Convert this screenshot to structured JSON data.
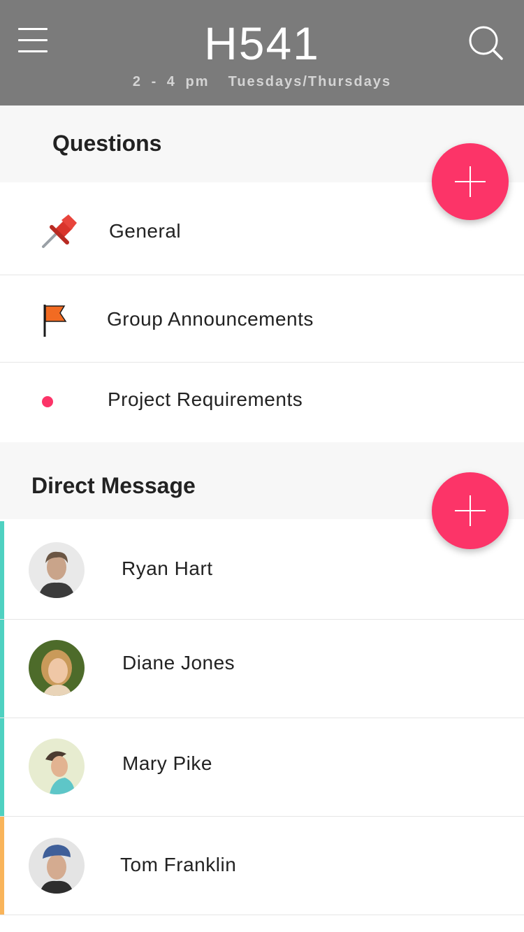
{
  "header": {
    "title": "H541",
    "subtitle": "2 - 4 pm  Tuesdays/Thursdays",
    "menu_icon": "hamburger-menu-icon",
    "search_icon": "search-icon"
  },
  "questions": {
    "title": "Questions",
    "items": [
      {
        "label": "General",
        "icon": "pushpin-icon"
      },
      {
        "label": "Group Announcements",
        "icon": "flag-icon"
      },
      {
        "label": "Project Requirements",
        "icon": "dot-icon"
      }
    ]
  },
  "direct_message": {
    "title": "Direct Message",
    "contacts": [
      {
        "name": "Ryan Hart",
        "accent": "#4fd1c1"
      },
      {
        "name": "Diane Jones",
        "accent": "#4fd1c1"
      },
      {
        "name": "Mary Pike",
        "accent": "#4fd1c1"
      },
      {
        "name": "Tom Franklin",
        "accent": "#f9b45a"
      }
    ]
  },
  "colors": {
    "header_bg": "#7b7b7b",
    "fab": "#fc3468",
    "accent_teal": "#4fd1c1",
    "accent_orange": "#f9b45a"
  }
}
